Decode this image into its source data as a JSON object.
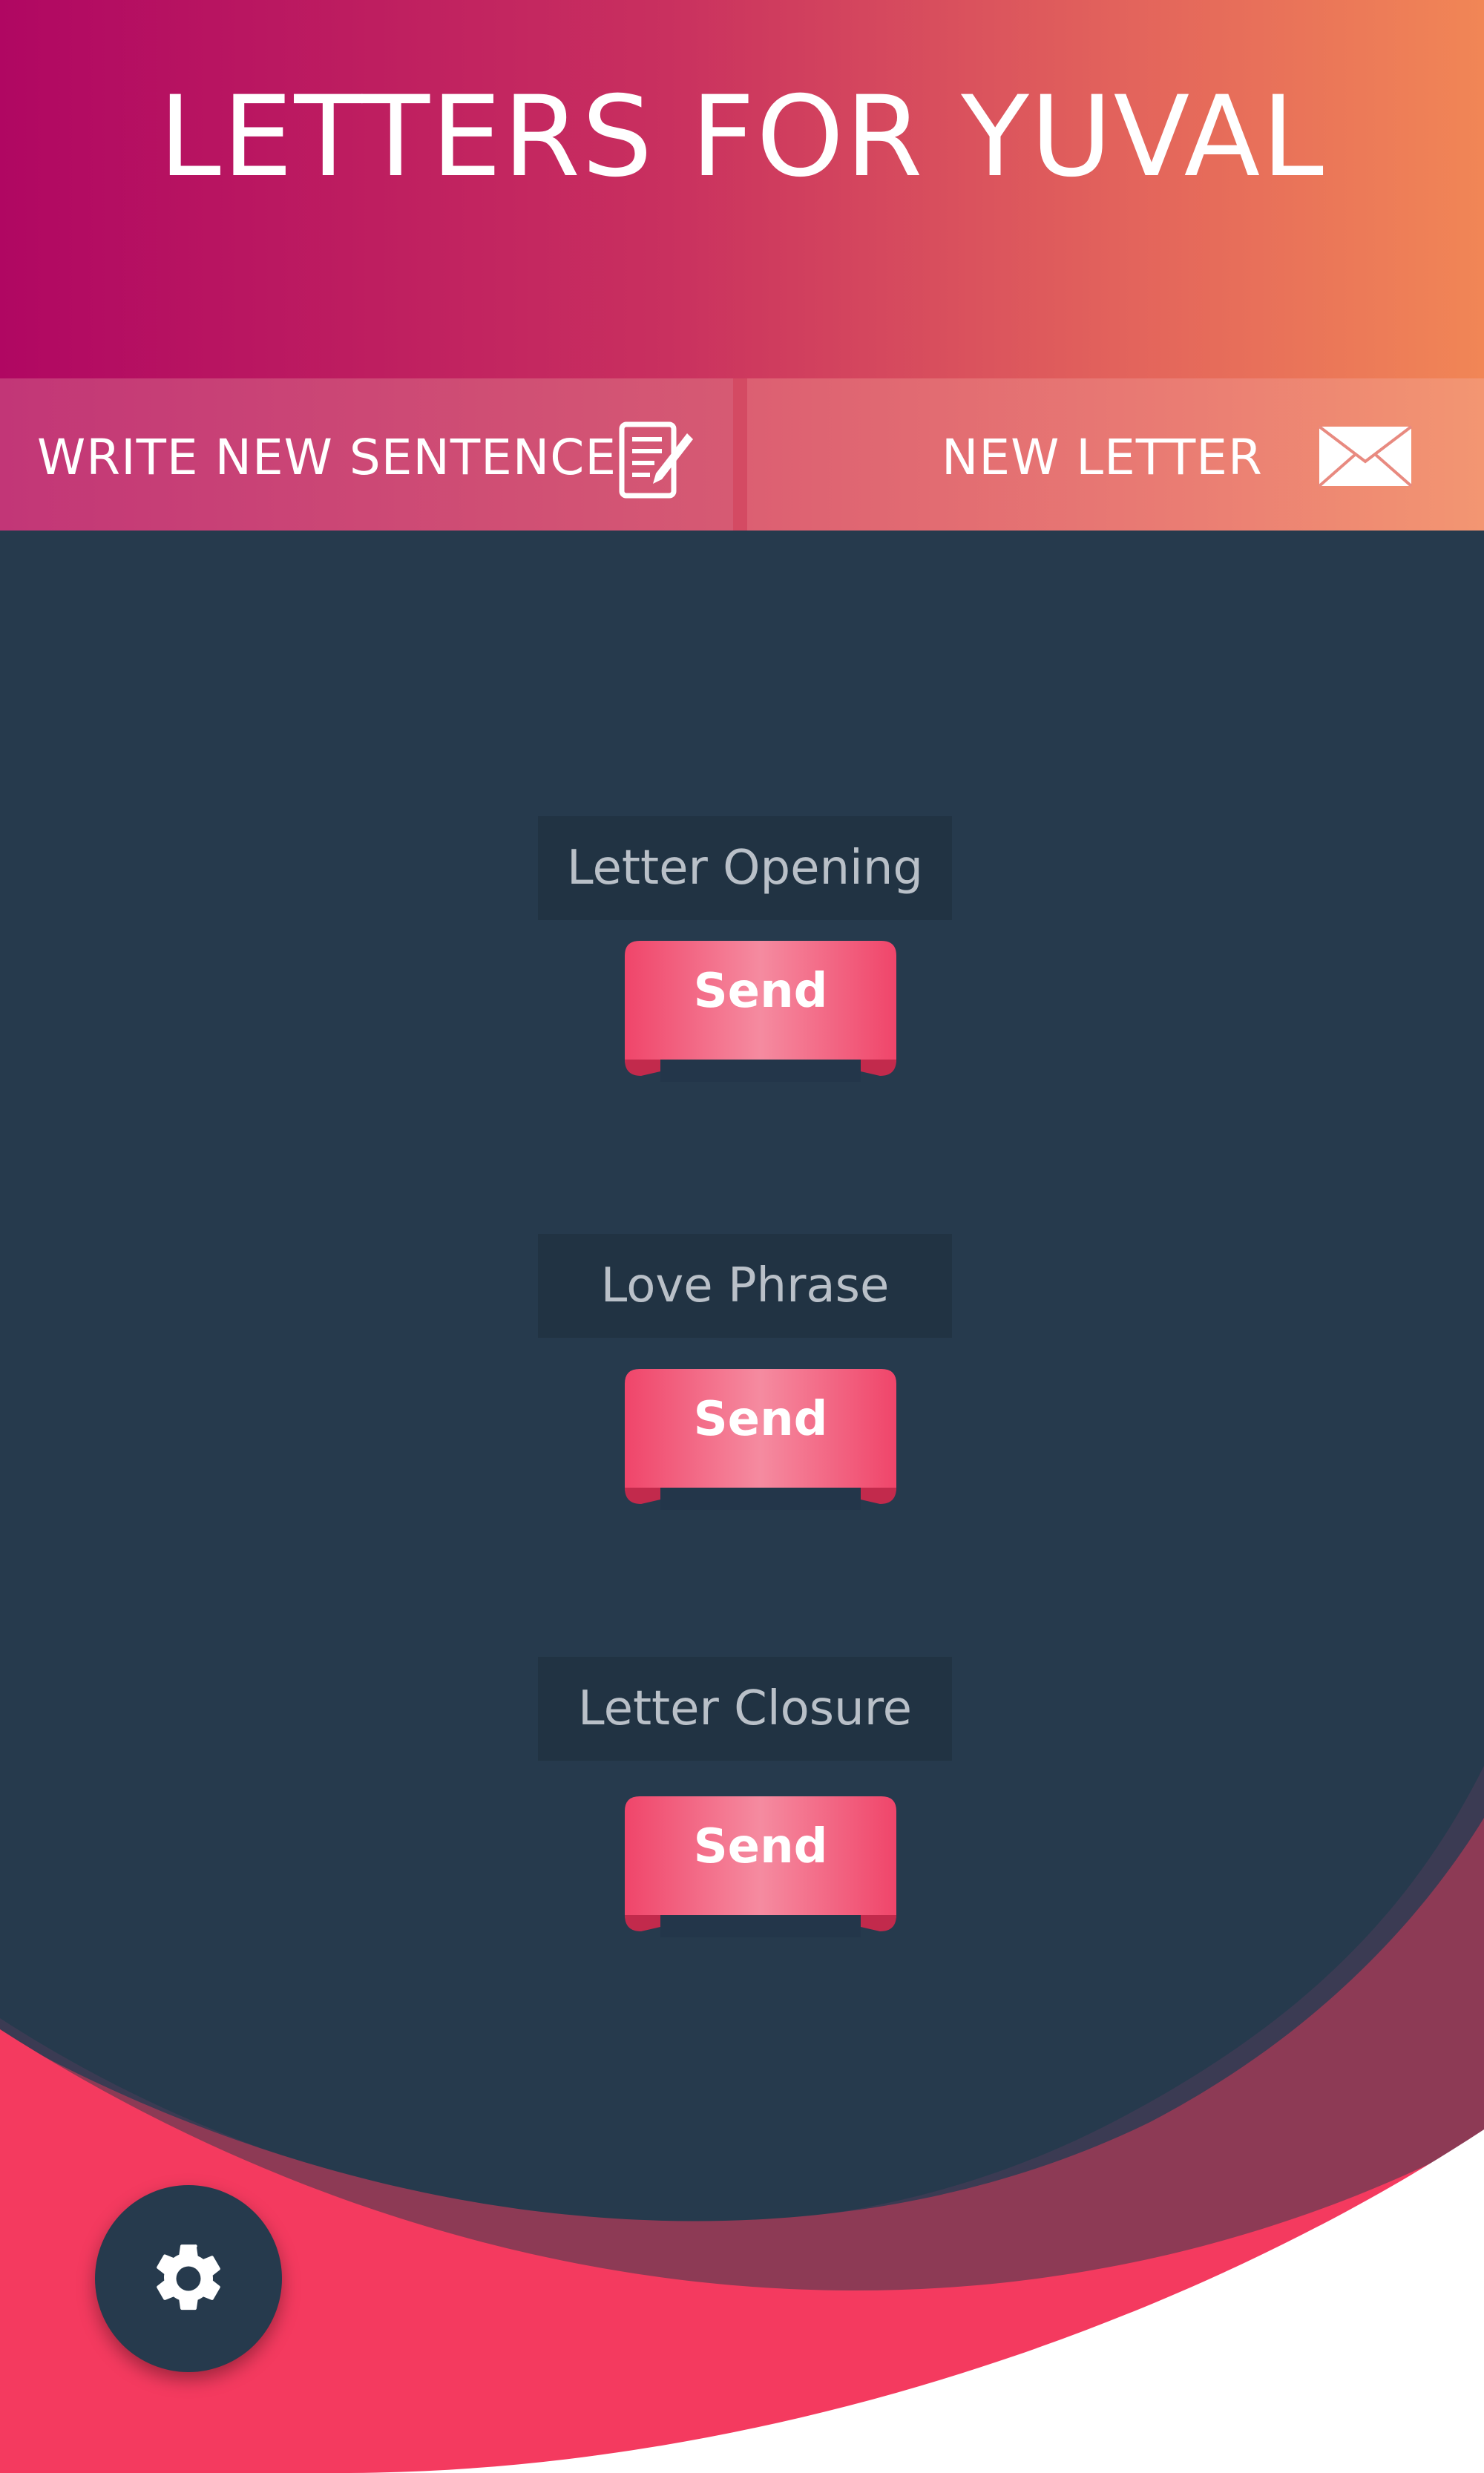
{
  "header": {
    "title": "LETTERS FOR YUVAL"
  },
  "tabs": {
    "write": {
      "label": "WRITE NEW SENTENCE",
      "icon": "edit-document-icon"
    },
    "letter": {
      "label": "NEW LETTER",
      "icon": "envelope-icon"
    }
  },
  "sections": [
    {
      "label": "Letter Opening",
      "button": "Send"
    },
    {
      "label": "Love Phrase",
      "button": "Send"
    },
    {
      "label": "Letter Closure",
      "button": "Send"
    }
  ],
  "fab": {
    "icon": "settings-gear-icon"
  },
  "colors": {
    "background": "#263a4d",
    "header_start": "#b00762",
    "header_end": "#f18656",
    "accent_pink": "#f43a5f",
    "wave_maroon": "#8d3a55",
    "ribbon": "#f0456a"
  }
}
